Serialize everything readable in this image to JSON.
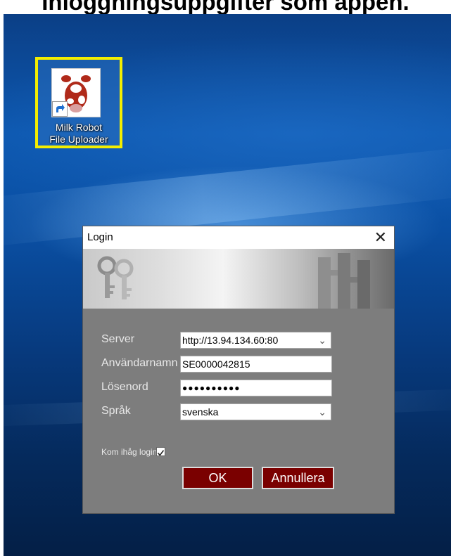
{
  "caption": "Inloggningsuppgifter som appen.",
  "desktop": {
    "icon": {
      "label_line1": "Milk Robot",
      "label_line2": "File Uploader",
      "highlight_color": "#f3ee00"
    }
  },
  "dialog": {
    "title": "Login",
    "close_glyph": "✕",
    "fields": {
      "server_label": "Server",
      "server_value": "http://13.94.134.60:80",
      "username_label": "Användarnamn",
      "username_value": "SE0000042815",
      "password_label": "Lösenord",
      "password_value": "●●●●●●●●●●",
      "language_label": "Språk",
      "language_value": "svenska"
    },
    "remember_label": "Kom ihåg login",
    "remember_checked": true,
    "ok_label": "OK",
    "cancel_label": "Annullera",
    "accent_color": "#7a0000"
  }
}
